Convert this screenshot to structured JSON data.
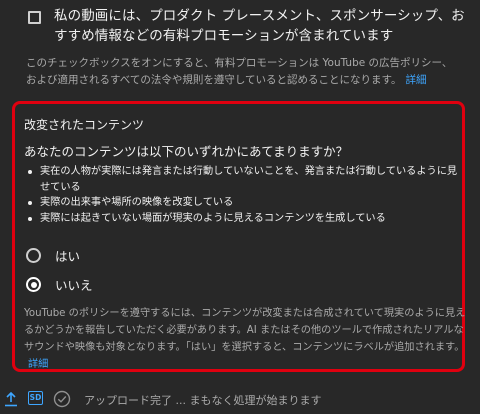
{
  "paid_promotion": {
    "label": "私の動画には、プロダクト プレースメント、スポンサーシップ、おすすめ情報などの有料プロモーションが含まれています",
    "checked": false,
    "description": "このチェックボックスをオンにすると、有料プロモーションは YouTube の広告ポリシー、および適用されるすべての法令や規則を遵守していると認めることになります。",
    "learn_more": "詳細"
  },
  "altered_content": {
    "title": "改変されたコンテンツ",
    "question": "あなたのコンテンツは以下のいずれかにあてまりますか？",
    "bullets": [
      "実在の人物が実際には発言または行動していないことを、発言または行動しているように見せている",
      "実際の出来事や場所の映像を改変している",
      "実際には起きていない場面が現実のように見えるコンテンツを生成している"
    ],
    "options": [
      {
        "label": "はい",
        "selected": false
      },
      {
        "label": "いいえ",
        "selected": true
      }
    ],
    "description": "YouTube のポリシーを遵守するには、コンテンツが改変または合成されていて現実のように見えるかどうかを報告していただく必要があります。AI またはその他のツールで作成されたリアルなサウンドや映像も対象となります。「はい」を選択すると、コンテンツにラベルが追加されます。",
    "learn_more": "詳細",
    "highlight_color": "#e0000f"
  },
  "status_bar": {
    "icons": [
      "upload-icon",
      "sd-badge",
      "check-circle-icon"
    ],
    "sd_label": "SD",
    "text": "アップロード完了 ... まもなく処理が始まります"
  },
  "colors": {
    "background": "#282828",
    "text": "#f1f1f1",
    "secondary_text": "#aaaaaa",
    "link": "#3ea6ff"
  }
}
